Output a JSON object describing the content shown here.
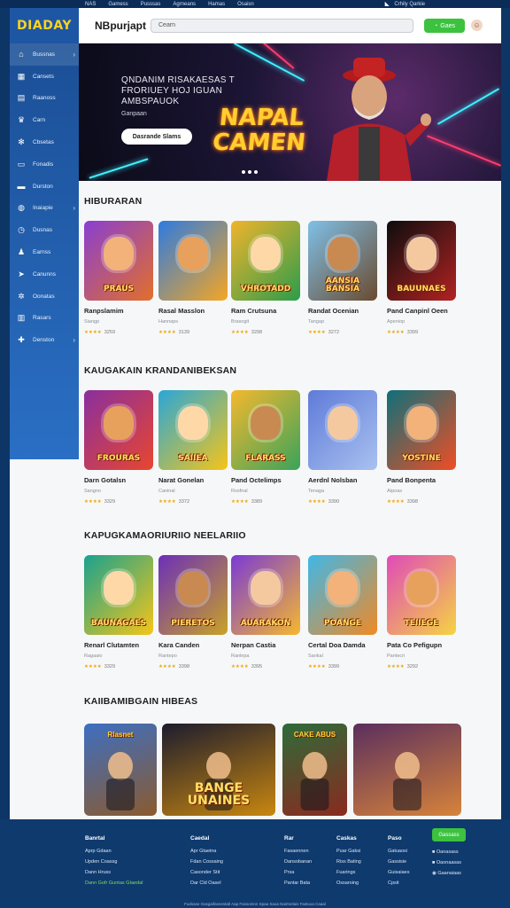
{
  "topbar": {
    "links": [
      "NAS",
      "Gamess",
      "Pusssas",
      "Agrneans",
      "Hamas",
      "Osaisn"
    ],
    "right_label": "Crhily Qarkie"
  },
  "header": {
    "logo": "DIADAY",
    "site_name": "NBpurjapt",
    "search_placeholder": "Cearn",
    "login_label": "Gaes",
    "avatar_icon": "user-avatar"
  },
  "sidebar": {
    "items": [
      {
        "label": "Bussnas",
        "icon": "home-icon",
        "chevron": true
      },
      {
        "label": "Cansets",
        "icon": "grid-icon",
        "chevron": false
      },
      {
        "label": "Raanoss",
        "icon": "chart-icon",
        "chevron": false
      },
      {
        "label": "Carn",
        "icon": "trophy-icon",
        "chevron": false
      },
      {
        "label": "Cbsetas",
        "icon": "gear-icon",
        "chevron": false
      },
      {
        "label": "Fonadis",
        "icon": "window-icon",
        "chevron": false
      },
      {
        "label": "Durston",
        "icon": "folder-icon",
        "chevron": false
      },
      {
        "label": "Inaiapie",
        "icon": "globe-icon",
        "chevron": true
      },
      {
        "label": "Dusnas",
        "icon": "clock-icon",
        "chevron": false
      },
      {
        "label": "Earnss",
        "icon": "people-icon",
        "chevron": false
      },
      {
        "label": "Canunns",
        "icon": "rocket-icon",
        "chevron": false
      },
      {
        "label": "Oonatas",
        "icon": "settings-icon",
        "chevron": false
      },
      {
        "label": "Rasars",
        "icon": "book-icon",
        "chevron": false
      },
      {
        "label": "Denston",
        "icon": "gift-icon",
        "chevron": true
      }
    ]
  },
  "hero": {
    "headline": "QNDANIM RISAKAESAS T FRORIUEY HOJ IGUAN AMBSPAUOK",
    "sub": "Ganpaan",
    "button": "Dasrande Slams",
    "title": "NAPAL CAMEN",
    "slides": 3
  },
  "sections": [
    {
      "title": "HIBURARAN",
      "cards": [
        {
          "title": "Ranpslamim",
          "meta": "Siangp",
          "rating": "3259",
          "thumb_text": "PRAUS",
          "bg": [
            "#8a3fd1",
            "#e26f2a"
          ]
        },
        {
          "title": "Rasal Masslon",
          "meta": "Hannaps",
          "rating": "3139",
          "thumb_text": "",
          "bg": [
            "#2d7be0",
            "#f5a623"
          ]
        },
        {
          "title": "Ram Crutsuna",
          "meta": "Brasogit",
          "rating": "3298",
          "thumb_text": "VHROTADD",
          "bg": [
            "#f0b42c",
            "#2c9c4a"
          ]
        },
        {
          "title": "Randat Ocenian",
          "meta": "Tangap",
          "rating": "3272",
          "thumb_text": "AANSIA BANSIA",
          "bg": [
            "#7fc0e8",
            "#6a4a2e"
          ]
        },
        {
          "title": "Pand Canpinl Oeen",
          "meta": "Apeniop",
          "rating": "3399",
          "thumb_text": "BAUUNAES",
          "bg": [
            "#0d0d0d",
            "#b22222"
          ]
        }
      ]
    },
    {
      "title": "KAUGAKAIN KRANDANIBEKSAN",
      "cards": [
        {
          "title": "Darn Gotalsn",
          "meta": "Sangno",
          "rating": "3329",
          "thumb_text": "FROURAS",
          "bg": [
            "#8a2f9e",
            "#e8462f"
          ]
        },
        {
          "title": "Narat Gonelan",
          "meta": "Caninal",
          "rating": "3372",
          "thumb_text": "SAIIEA",
          "bg": [
            "#2aa7d8",
            "#f5c518"
          ]
        },
        {
          "title": "Pand Octelimps",
          "meta": "Rosfnal",
          "rating": "3389",
          "thumb_text": "FLARASS",
          "bg": [
            "#f5b82e",
            "#3aa35a"
          ]
        },
        {
          "title": "Aerdnl Nolsban",
          "meta": "Tenaga",
          "rating": "3390",
          "thumb_text": "",
          "bg": [
            "#5f7bd8",
            "#a9c1f0"
          ]
        },
        {
          "title": "Pand Bonpenta",
          "meta": "Atpoas",
          "rating": "3398",
          "thumb_text": "YOSTINE",
          "bg": [
            "#0e6f7a",
            "#f04e23"
          ]
        }
      ]
    },
    {
      "title": "KAPUGKAMAORIURIIO NEELARIIO",
      "cards": [
        {
          "title": "Renarl Clutamten",
          "meta": "Ragaaio",
          "rating": "3329",
          "thumb_text": "BAUNAGAES",
          "bg": [
            "#1aa28e",
            "#f5c518"
          ]
        },
        {
          "title": "Kara Canden",
          "meta": "Rantepo",
          "rating": "3398",
          "thumb_text": "PIERETOS",
          "bg": [
            "#6b2fb8",
            "#c9a227"
          ]
        },
        {
          "title": "Nerpan Castia",
          "meta": "Ranlepa",
          "rating": "3395",
          "thumb_text": "AUARAKON",
          "bg": [
            "#7a3ad6",
            "#f5b82e"
          ]
        },
        {
          "title": "Certal Doa Damda",
          "meta": "Sankal",
          "rating": "3399",
          "thumb_text": "POANGE",
          "bg": [
            "#3fb7e8",
            "#f08a24"
          ]
        },
        {
          "title": "Pata Co Pefigupn",
          "meta": "Pantecri",
          "rating": "3292",
          "thumb_text": "TEIIEGE",
          "bg": [
            "#e04ab8",
            "#f5d442"
          ]
        }
      ]
    },
    {
      "title": "KAIIBAMIBGAIN HIBEAS",
      "wide": [
        {
          "label": "Rlasnet",
          "title": "",
          "bg": [
            "#3d6fc2",
            "#8a5a2e"
          ]
        },
        {
          "label": "",
          "title": "BANGE UNAINES",
          "bg": [
            "#1c1c2e",
            "#c9870f"
          ]
        },
        {
          "label": "CAKE ABUS",
          "title": "",
          "bg": [
            "#2e6b3a",
            "#8a2a1e"
          ]
        },
        {
          "label": "",
          "title": "",
          "bg": [
            "#5a2f5e",
            "#d7833a"
          ]
        }
      ]
    }
  ],
  "footer": {
    "columns": [
      {
        "heading": "Banrtal",
        "items": [
          "Aprp Gdaan",
          "Upden Coassg",
          "Dann Hruss",
          "Dann Gofr Guntas Gtaedal"
        ]
      },
      {
        "heading": "Caedal",
        "items": [
          "Apr Gtaeina",
          "Fdan Cossaing",
          "Casonder Stit",
          "Dar Cld Oasel"
        ]
      },
      {
        "heading": "Rar",
        "items": [
          "Fasaennen",
          "Dansobanan",
          "Prsa",
          "Pantar Bata"
        ]
      },
      {
        "heading": "Caskas",
        "items": [
          "Puar Gaksi",
          "Riss Bating",
          "Fuarings",
          "Ossaroing"
        ]
      },
      {
        "heading": "Paso",
        "items": [
          "Gatuaosi",
          "Gassisie",
          "Guisaiaes",
          "Cpsit"
        ]
      }
    ],
    "button": "Gassass",
    "side_items": [
      "Oanasass",
      "Oaonaasas",
      "Gaanaiaas"
    ],
    "copyright": "Fudsase Gasgaifasnestatl Aap Fassomnn Spaa Saoa Nairtnelais Fastuoa Caaal"
  }
}
